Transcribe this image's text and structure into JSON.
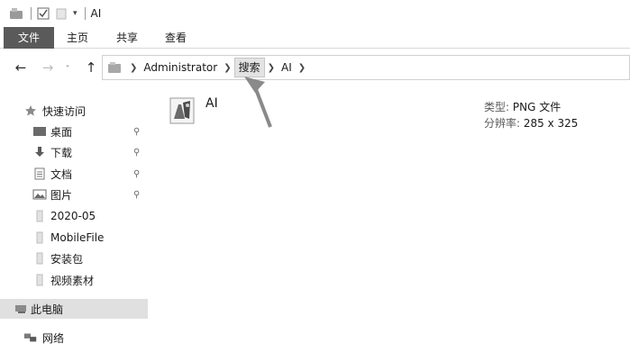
{
  "window": {
    "title": "AI"
  },
  "ribbon": {
    "tabs": [
      "文件",
      "主页",
      "共享",
      "查看"
    ]
  },
  "address": {
    "crumbs": [
      "Administrator",
      "搜索",
      "AI"
    ]
  },
  "sidebar": {
    "quick_access": "快速访问",
    "items": [
      "桌面",
      "下载",
      "文档",
      "图片",
      "2020-05",
      "MobileFile",
      "安装包",
      "视频素材"
    ],
    "this_pc": "此电脑",
    "network": "网络"
  },
  "file": {
    "name": "AI",
    "type_label": "类型:",
    "type_value": "PNG 文件",
    "dim_label": "分辨率:",
    "dim_value": "285 x 325"
  },
  "icons": {
    "quick_access": "star-icon",
    "desktop": "desktop-icon",
    "downloads": "download-icon",
    "documents": "document-icon",
    "pictures": "pictures-icon",
    "folders": "folder-icon",
    "this_pc": "computer-icon",
    "network": "network-icon",
    "pin": "pin-icon"
  },
  "colors": {
    "file_tab_bg": "#5a5a5a",
    "selected_bg": "#e0e0e0",
    "crumb_active_bg": "#e3e3e3",
    "arrow": "#8a8a8a"
  }
}
